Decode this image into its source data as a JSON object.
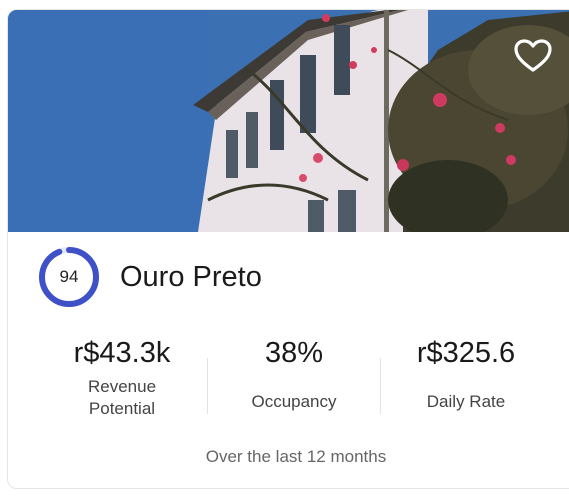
{
  "card": {
    "score": "94",
    "score_ratio": 0.94,
    "city": "Ouro Preto",
    "favorite_icon": "heart-outline-icon",
    "stats": [
      {
        "value": "r$43.3k",
        "label": "Revenue Potential"
      },
      {
        "value": "38%",
        "label": "Occupancy"
      },
      {
        "value": "r$325.6",
        "label": "Daily Rate"
      }
    ],
    "footnote": "Over the last 12 months"
  },
  "colors": {
    "score_ring": "#3f51c6",
    "sky": "#3b6fb0",
    "building": "#e7e1e6",
    "foliage": "#3b3a2a"
  }
}
